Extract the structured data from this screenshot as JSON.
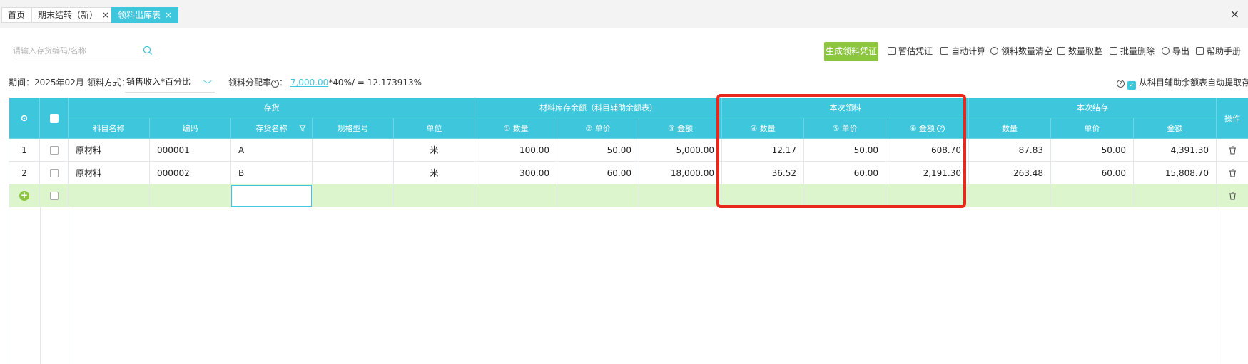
{
  "tabs": [
    {
      "label": "首页",
      "closable": false,
      "active": false
    },
    {
      "label": "期末结转（新）",
      "closable": true,
      "active": false
    },
    {
      "label": "领料出库表",
      "closable": true,
      "active": true
    }
  ],
  "window": {
    "close_symbol": "×"
  },
  "search": {
    "placeholder": "请输入存货编码/名称"
  },
  "toolbar": {
    "generate_voucher": "生成领料凭证",
    "estimate_voucher": "暂估凭证",
    "auto_calc": "自动计算",
    "clear_quantity": "领料数量清空",
    "round_quantity": "数量取整",
    "batch_delete": "批量删除",
    "export": "导出",
    "help_manual": "帮助手册"
  },
  "filters": {
    "period_label": "期间：",
    "period_value": "2025年02月",
    "method_label": "领料方式：",
    "method_value": "销售收入*百分比",
    "rate_label": "领料分配率",
    "rate_colon": "：",
    "rate_base": "7,000.00",
    "rate_formula": "*40%/",
    "rate_equals": "=",
    "rate_result": "12.173913%",
    "auto_fetch_label": "从科目辅助余额表自动提取存货"
  },
  "table": {
    "group_headers": {
      "inventory": "存货",
      "stock_balance": "材料库存余额（科目辅助余额表）",
      "current_issue": "本次领料",
      "current_balance": "本次结存",
      "actions": "操作"
    },
    "columns": {
      "subject_name": "科目名称",
      "code": "编码",
      "inventory_name": "存货名称",
      "spec": "规格型号",
      "unit": "单位",
      "stock_qty": "① 数量",
      "stock_price": "② 单价",
      "stock_amount": "③ 金额",
      "issue_qty": "④ 数量",
      "issue_price": "⑤ 单价",
      "issue_amount": "⑥ 金额",
      "bal_qty": "数量",
      "bal_price": "单价",
      "bal_amount": "金额"
    },
    "rows": [
      {
        "no": "1",
        "subject_name": "原材料",
        "code": "000001",
        "inventory_name": "A",
        "spec": "",
        "unit": "米",
        "stock_qty": "100.00",
        "stock_price": "50.00",
        "stock_amount": "5,000.00",
        "issue_qty": "12.17",
        "issue_price": "50.00",
        "issue_amount": "608.70",
        "bal_qty": "87.83",
        "bal_price": "50.00",
        "bal_amount": "4,391.30"
      },
      {
        "no": "2",
        "subject_name": "原材料",
        "code": "000002",
        "inventory_name": "B",
        "spec": "",
        "unit": "米",
        "stock_qty": "300.00",
        "stock_price": "60.00",
        "stock_amount": "18,000.00",
        "issue_qty": "36.52",
        "issue_price": "60.00",
        "issue_amount": "2,191.30",
        "bal_qty": "263.48",
        "bal_price": "60.00",
        "bal_amount": "15,808.70"
      }
    ]
  },
  "colors": {
    "accent": "#3ec6dc",
    "primary_button": "#8cc63f",
    "new_row": "#dcf5cd",
    "highlight": "#e8281d"
  }
}
